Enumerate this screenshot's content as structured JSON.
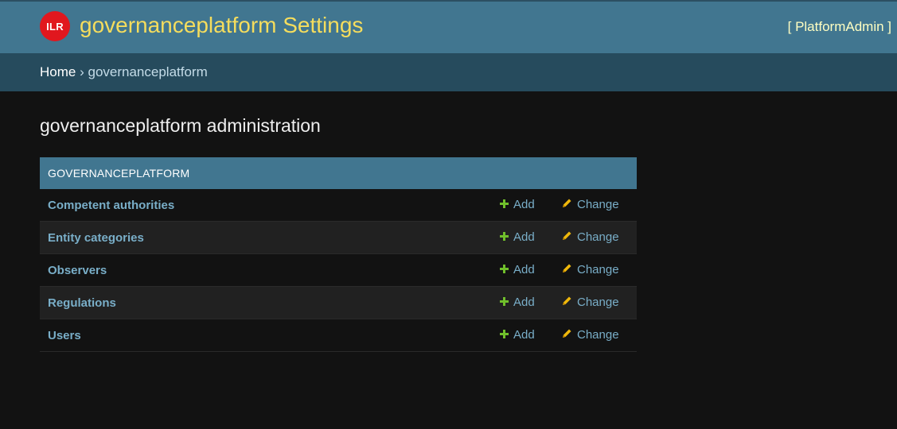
{
  "header": {
    "logo_text": "ILR",
    "site_title": "governanceplatform Settings",
    "user_tools": "[ PlatformAdmin ]",
    "colors": {
      "header_bg": "#417690",
      "title": "#f5dd5d",
      "logo": "#e1171e"
    }
  },
  "breadcrumbs": {
    "home": "Home",
    "separator": "›",
    "current": "governanceplatform"
  },
  "page": {
    "title": "governanceplatform administration"
  },
  "module": {
    "caption": "GOVERNANCEPLATFORM",
    "models": [
      {
        "name": "Competent authorities",
        "add": "Add",
        "change": "Change"
      },
      {
        "name": "Entity categories",
        "add": "Add",
        "change": "Change"
      },
      {
        "name": "Observers",
        "add": "Add",
        "change": "Change"
      },
      {
        "name": "Regulations",
        "add": "Add",
        "change": "Change"
      },
      {
        "name": "Users",
        "add": "Add",
        "change": "Change"
      }
    ],
    "icons": {
      "add": "plus-icon",
      "change": "pencil-icon"
    }
  }
}
